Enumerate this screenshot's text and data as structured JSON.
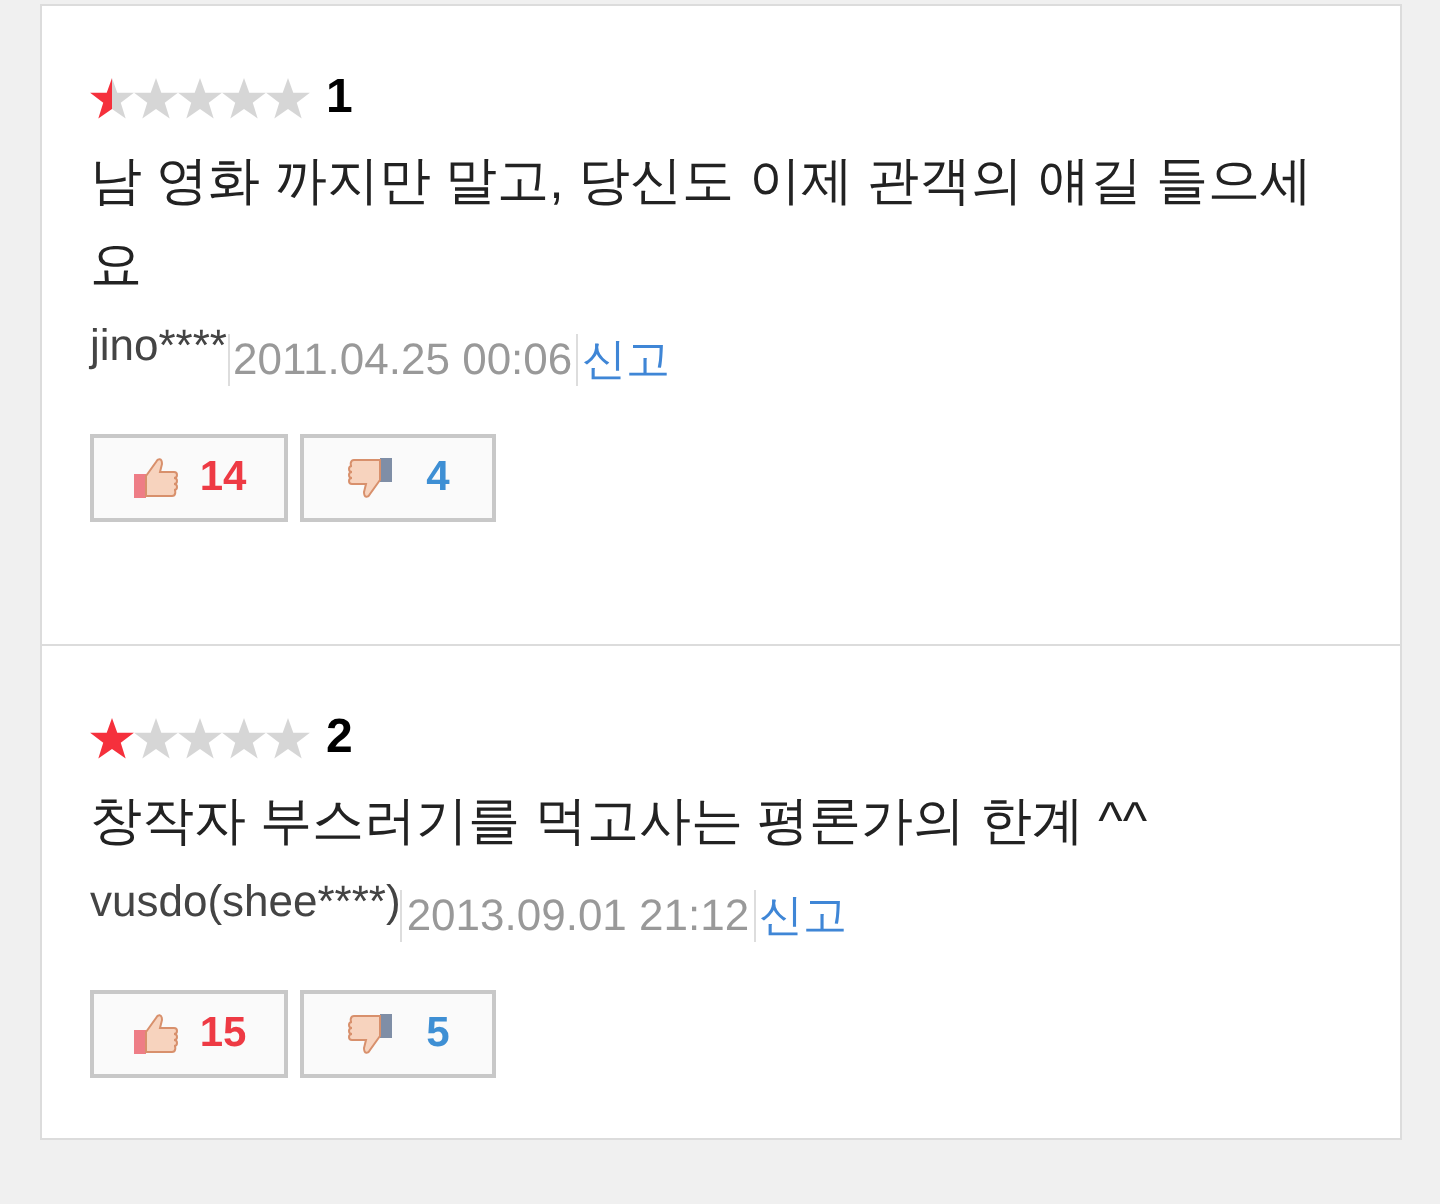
{
  "reviews": [
    {
      "stars": 0.5,
      "score": "1",
      "text": "남 영화 까지만 말고, 당신도 이제 관객의 얘길 들으세요",
      "author": "jino****",
      "date": "2011.04.25 00:06",
      "report": "신고",
      "likes": "14",
      "dislikes": "4"
    },
    {
      "stars": 1,
      "score": "2",
      "text": "창작자 부스러기를 먹고사는 평론가의 한계 ^^",
      "author": "vusdo(shee****)",
      "date": "2013.09.01 21:12",
      "report": "신고",
      "likes": "15",
      "dislikes": "5"
    }
  ]
}
